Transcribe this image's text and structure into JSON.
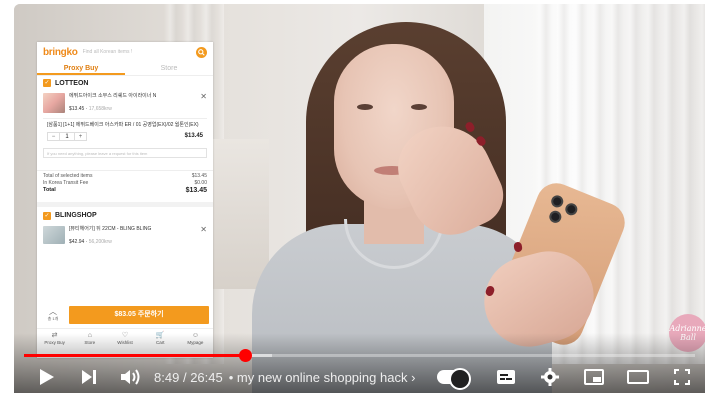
{
  "app": {
    "logo": "bringko",
    "search_placeholder": "Find all Korean items !",
    "tabs": [
      {
        "label": "Proxy Buy",
        "active": true
      },
      {
        "label": "Store",
        "active": false
      }
    ],
    "shops": [
      {
        "name": "LOTTEON",
        "item": {
          "name": "에뛰드아이크 소무스 리쉐드 아이라이너 N",
          "price_usd": "$13.45",
          "price_krw": "17,658krw",
          "option": "[삼품1] [1+1] 에뛰드베이크 아스카파 ER / 01 공영업(EX)/02 웜톤인(EX)",
          "qty": "1",
          "option_price": "$13.45",
          "note_placeholder": "If you need anything, please leave a request for this item"
        },
        "summary": [
          {
            "label": "Total of selected items",
            "value": "$13.45"
          },
          {
            "label": "In Korea Transit Fee",
            "value": "$0.00"
          },
          {
            "label": "Total",
            "value": "$13.45"
          }
        ]
      },
      {
        "name": "BLINGSHOP",
        "item": {
          "name": "[뷰티헤어기] 뒤 22CM - BLING BLING",
          "price_usd": "$42.94",
          "price_krw": "56,200krw"
        }
      }
    ],
    "select_all_label": "총 1개",
    "order_button": "$83.05 주문하기",
    "nav": [
      {
        "icon": "proxy-buy-icon",
        "glyph": "⇄",
        "label": "Proxy Buy"
      },
      {
        "icon": "store-icon",
        "glyph": "⌂",
        "label": "Store"
      },
      {
        "icon": "wishlist-icon",
        "glyph": "♡",
        "label": "Wishlist"
      },
      {
        "icon": "cart-icon",
        "glyph": "🛒",
        "label": "Cart"
      },
      {
        "icon": "mypage-icon",
        "glyph": "☺",
        "label": "Mypage"
      }
    ]
  },
  "watermark": "Adrianne Ball",
  "player": {
    "current_time": "8:49",
    "duration": "26:45",
    "time_separator": "/",
    "chapter_title": "• my new online shopping hack",
    "chapter_arrow": "›",
    "progress_fraction": 0.33,
    "buffered_fraction": 0.37,
    "accent_color": "#ff0000"
  }
}
